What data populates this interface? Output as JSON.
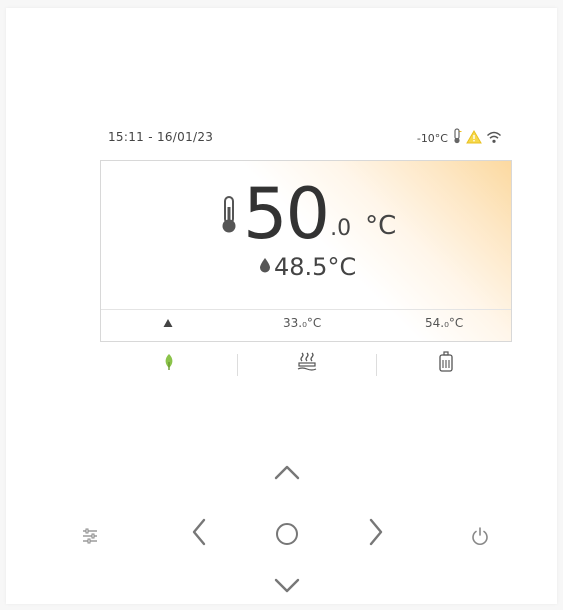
{
  "status_bar": {
    "datetime": "15:11 - 16/01/23",
    "outdoor_temp": "-10°C",
    "icons": [
      "outdoor-thermometer-icon",
      "warning-icon",
      "wifi-icon"
    ],
    "warning_color": "#f0c020"
  },
  "main": {
    "setpoint_int": "50",
    "setpoint_dec": ".0",
    "setpoint_unit": "°C",
    "current_temp": "48.5°C",
    "accent_color": "#fcd9a0"
  },
  "info_row": {
    "flow_temp": "33.₀°C",
    "tank_temp": "54.₀°C",
    "indicator_icon": "triangle-up-icon"
  },
  "tabs": [
    {
      "name": "heat-pump-tab",
      "icon": "leaf-icon",
      "color": "#8bc34a"
    },
    {
      "name": "floor-heating-tab",
      "icon": "floor-heating-icon"
    },
    {
      "name": "water-tank-tab",
      "icon": "water-tank-icon"
    }
  ],
  "keypad": {
    "keys": [
      "settings-sliders-icon",
      "arrow-up-icon",
      "arrow-left-icon",
      "ok-circle-icon",
      "arrow-right-icon",
      "arrow-down-icon",
      "power-icon"
    ]
  }
}
